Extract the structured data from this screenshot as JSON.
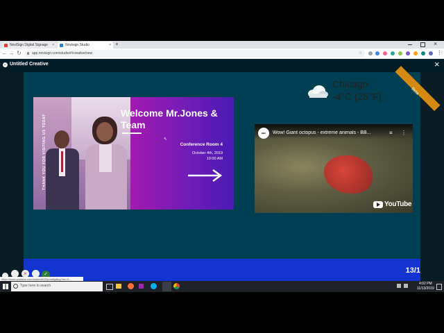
{
  "browser": {
    "tabs": [
      {
        "label": "NoviSign Digital Signage",
        "close": "×"
      },
      {
        "label": "Novisign Studio",
        "close": "×"
      }
    ],
    "new_tab": "+",
    "url": "app.novisign.com/studio/#/creative/new",
    "status_url": "https://www.youtube.com/embed/KZ2pnm6gBug?rel=0..."
  },
  "app": {
    "title": "Untitled Creative",
    "ribbon": "Beta",
    "close_icon": "×"
  },
  "weather": {
    "city": "Chicago",
    "temp": "-4°C (25°F)",
    "icon": "cloud-icon"
  },
  "welcome": {
    "vertical_text": "THANK YOU FOR VISITING US TODAY",
    "headline_line1": "Welcome Mr.Jones &",
    "headline_line2": "Team",
    "room": "Conference Room 4",
    "date": "October 4th, 2019",
    "time": "10:00 AM"
  },
  "video": {
    "title": "Wow! Giant octopus - extreme animals - BB...",
    "channel": "BBC STUDIOS",
    "brand": "YouTube"
  },
  "footer": {
    "counter": "13/1"
  },
  "taskbar": {
    "search_placeholder": "Type here to search",
    "time": "4:02 PM",
    "date": "11/13/2019"
  },
  "colors": {
    "stage": "#003f51",
    "footer": "#1434cf",
    "ribbon": "#d48a10"
  }
}
